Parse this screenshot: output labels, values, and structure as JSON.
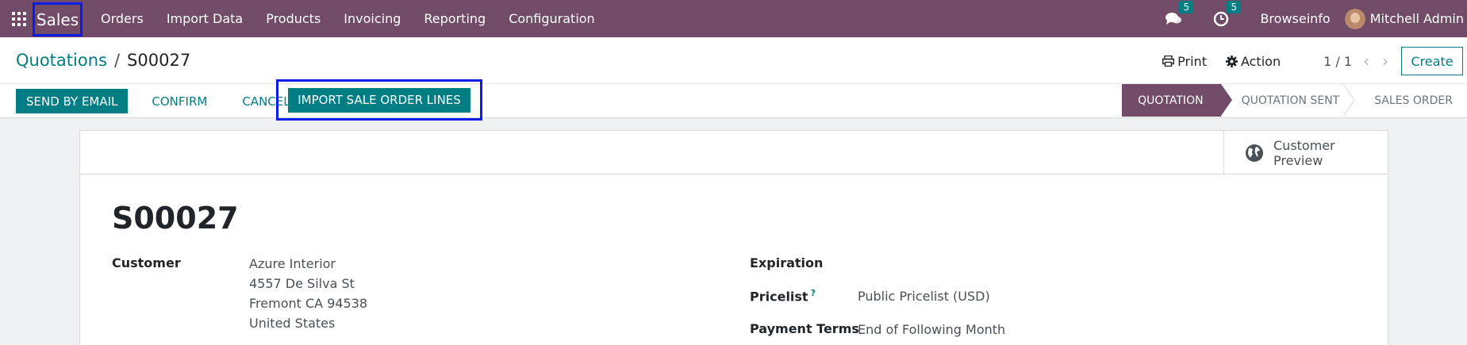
{
  "navbar": {
    "app_name": "Sales",
    "menu": [
      "Orders",
      "Import Data",
      "Products",
      "Invoicing",
      "Reporting",
      "Configuration"
    ],
    "messages_count": "5",
    "activities_count": "5",
    "company": "Browseinfo",
    "user": "Mitchell Admin"
  },
  "breadcrumb": {
    "parent": "Quotations",
    "separator": "/",
    "current": "S00027"
  },
  "control": {
    "print_label": "Print",
    "action_label": "Action",
    "pager": "1 / 1",
    "create_label": "Create"
  },
  "actions": {
    "send_email": "Send by Email",
    "confirm": "Confirm",
    "cancel": "Cancel",
    "import_lines": "Import Sale Order Lines"
  },
  "statusbar": [
    "Quotation",
    "Quotation Sent",
    "Sales Order"
  ],
  "form": {
    "preview_label": "Customer Preview",
    "name": "S00027",
    "customer_label": "Customer",
    "customer_lines": [
      "Azure Interior",
      "4557 De Silva St",
      "Fremont CA 94538",
      "United States"
    ],
    "expiration_label": "Expiration",
    "pricelist_label": "Pricelist",
    "pricelist_help": "?",
    "pricelist_value": "Public Pricelist (USD)",
    "payment_terms_label": "Payment Terms",
    "payment_terms_value": "End of Following Month"
  },
  "colors": {
    "brand": "#714b67",
    "accent": "#017e84",
    "highlight": "#0a1ce6"
  }
}
